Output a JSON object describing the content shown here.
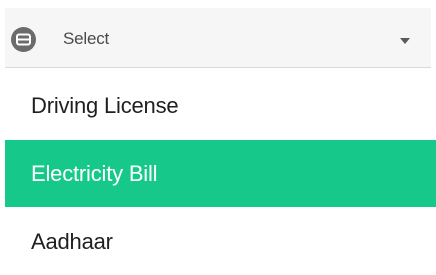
{
  "select": {
    "icon": "credit-card-icon",
    "value": "Select",
    "caret_icon": "caret-down-icon"
  },
  "dropdown": {
    "options": [
      {
        "label": "Driving License",
        "selected": false
      },
      {
        "label": "Electricity Bill",
        "selected": true
      },
      {
        "label": "Aadhaar",
        "selected": false
      }
    ]
  },
  "colors": {
    "highlight": "#16c98b",
    "select_background": "#f6f6f6",
    "text": "#1f1f1f"
  }
}
